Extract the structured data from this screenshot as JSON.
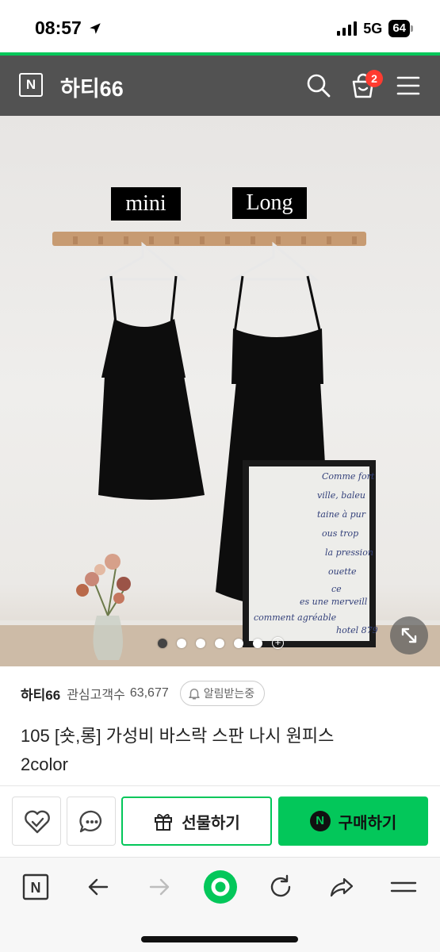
{
  "status_bar": {
    "time": "08:57",
    "network": "5G",
    "battery": "64"
  },
  "header": {
    "shop_name": "하티66",
    "cart_count": "2"
  },
  "photo": {
    "label_mini": "mini",
    "label_long": "Long",
    "frame_text": [
      "Comme fort",
      "ville, baleu",
      "taine à pur",
      "ous trop",
      "la pression",
      "ouette",
      "ce",
      "es une merveill",
      "comment agréable",
      "hotel 879"
    ],
    "carousel": {
      "total": 6,
      "active_index": 0
    }
  },
  "info": {
    "store_name": "하티66",
    "fans_label": "관심고객수",
    "fans_count": "63,677",
    "alarm_label": "알림받는중",
    "product_title_line1": "105 [숏,롱] 가성비 바스락 스판 나시 원피스",
    "product_title_line2": "2color"
  },
  "actions": {
    "gift_label": "선물하기",
    "buy_label": "구매하기",
    "npay_mark": "N"
  },
  "colors": {
    "naver_green": "#03c75a",
    "header_bg": "#525252",
    "badge_red": "#ff3b30"
  }
}
